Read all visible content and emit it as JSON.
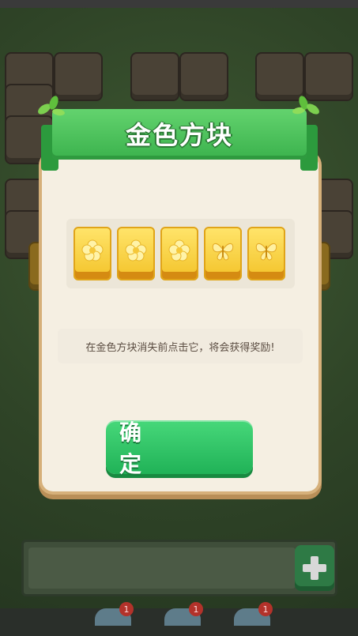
{
  "dialog": {
    "title": "金色方块",
    "description": "在金色方块消失前点击它，将会获得奖励!",
    "confirm_label": "确　　定"
  },
  "gold_tiles": [
    {
      "icon": "flower-icon"
    },
    {
      "icon": "flower-icon"
    },
    {
      "icon": "flower-icon"
    },
    {
      "icon": "butterfly-icon"
    },
    {
      "icon": "butterfly-icon"
    }
  ],
  "tray": {
    "badges": [
      "1",
      "1",
      "1"
    ]
  },
  "colors": {
    "ribbon": "#3bb24d",
    "button": "#20b257",
    "gold": "#f3c32a",
    "panel": "#f5efe2"
  }
}
